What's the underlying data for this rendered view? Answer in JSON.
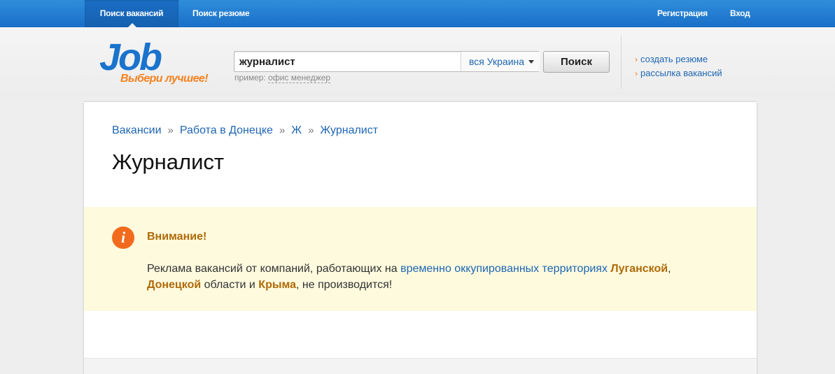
{
  "nav": {
    "tab_jobs": "Поиск вакансий",
    "tab_resume": "Поиск резюме",
    "register": "Регистрация",
    "login": "Вход"
  },
  "logo": {
    "word": "Job",
    "slogan": "Выбери лучшее!"
  },
  "search": {
    "query": "журналист",
    "region": "вся Украина",
    "button": "Поиск",
    "example_label": "пример:",
    "example_value": "офис менеджер"
  },
  "side_links": {
    "create_resume": "создать резюме",
    "newsletter": "рассылка вакансий",
    "arrow": "›"
  },
  "breadcrumb": {
    "items": [
      "Вакансии",
      "Работа в Донецке",
      "Ж",
      "Журналист"
    ],
    "separator": "»"
  },
  "page": {
    "title": "Журналист"
  },
  "notice": {
    "icon": "i",
    "title": "Внимание!",
    "text_1": "Реклама вакансий от компаний, работающих на ",
    "link_territories": "временно оккупированных территориях",
    "hl_lugansk": "Луганской",
    "comma": ",",
    "hl_donetsk": "Донецкой",
    "text_2": " области и ",
    "hl_crimea": "Крыма",
    "text_3": ", не производится!"
  },
  "colors": {
    "nav_blue": "#1a6fc7",
    "link_blue": "#1e66b3",
    "accent_orange": "#f58220",
    "notice_bg": "#fdfade",
    "highlight_brown": "#b06a08"
  }
}
